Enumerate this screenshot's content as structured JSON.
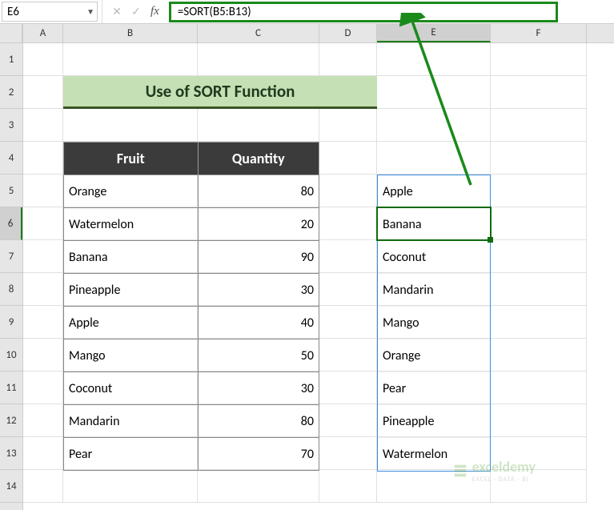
{
  "formula_bar": {
    "name_box": "E6",
    "formula": "=SORT(B5:B13)"
  },
  "columns": [
    "A",
    "B",
    "C",
    "D",
    "E",
    "F"
  ],
  "rows": [
    "1",
    "2",
    "3",
    "4",
    "5",
    "6",
    "7",
    "8",
    "9",
    "10",
    "11",
    "12",
    "13",
    "14"
  ],
  "selected_cell_ref": "E6",
  "title": "Use of SORT Function",
  "table": {
    "headers": [
      "Fruit",
      "Quantity"
    ],
    "data": [
      {
        "fruit": "Orange",
        "qty": "80"
      },
      {
        "fruit": "Watermelon",
        "qty": "20"
      },
      {
        "fruit": "Banana",
        "qty": "90"
      },
      {
        "fruit": "Pineapple",
        "qty": "30"
      },
      {
        "fruit": "Apple",
        "qty": "40"
      },
      {
        "fruit": "Mango",
        "qty": "50"
      },
      {
        "fruit": "Coconut",
        "qty": "30"
      },
      {
        "fruit": "Mandarin",
        "qty": "80"
      },
      {
        "fruit": "Pear",
        "qty": "70"
      }
    ]
  },
  "sorted_results": [
    "Apple",
    "Banana",
    "Coconut",
    "Mandarin",
    "Mango",
    "Orange",
    "Pear",
    "Pineapple",
    "Watermelon"
  ],
  "watermark": {
    "brand": "exceldemy",
    "tagline": "EXCEL · DATA · BI"
  }
}
